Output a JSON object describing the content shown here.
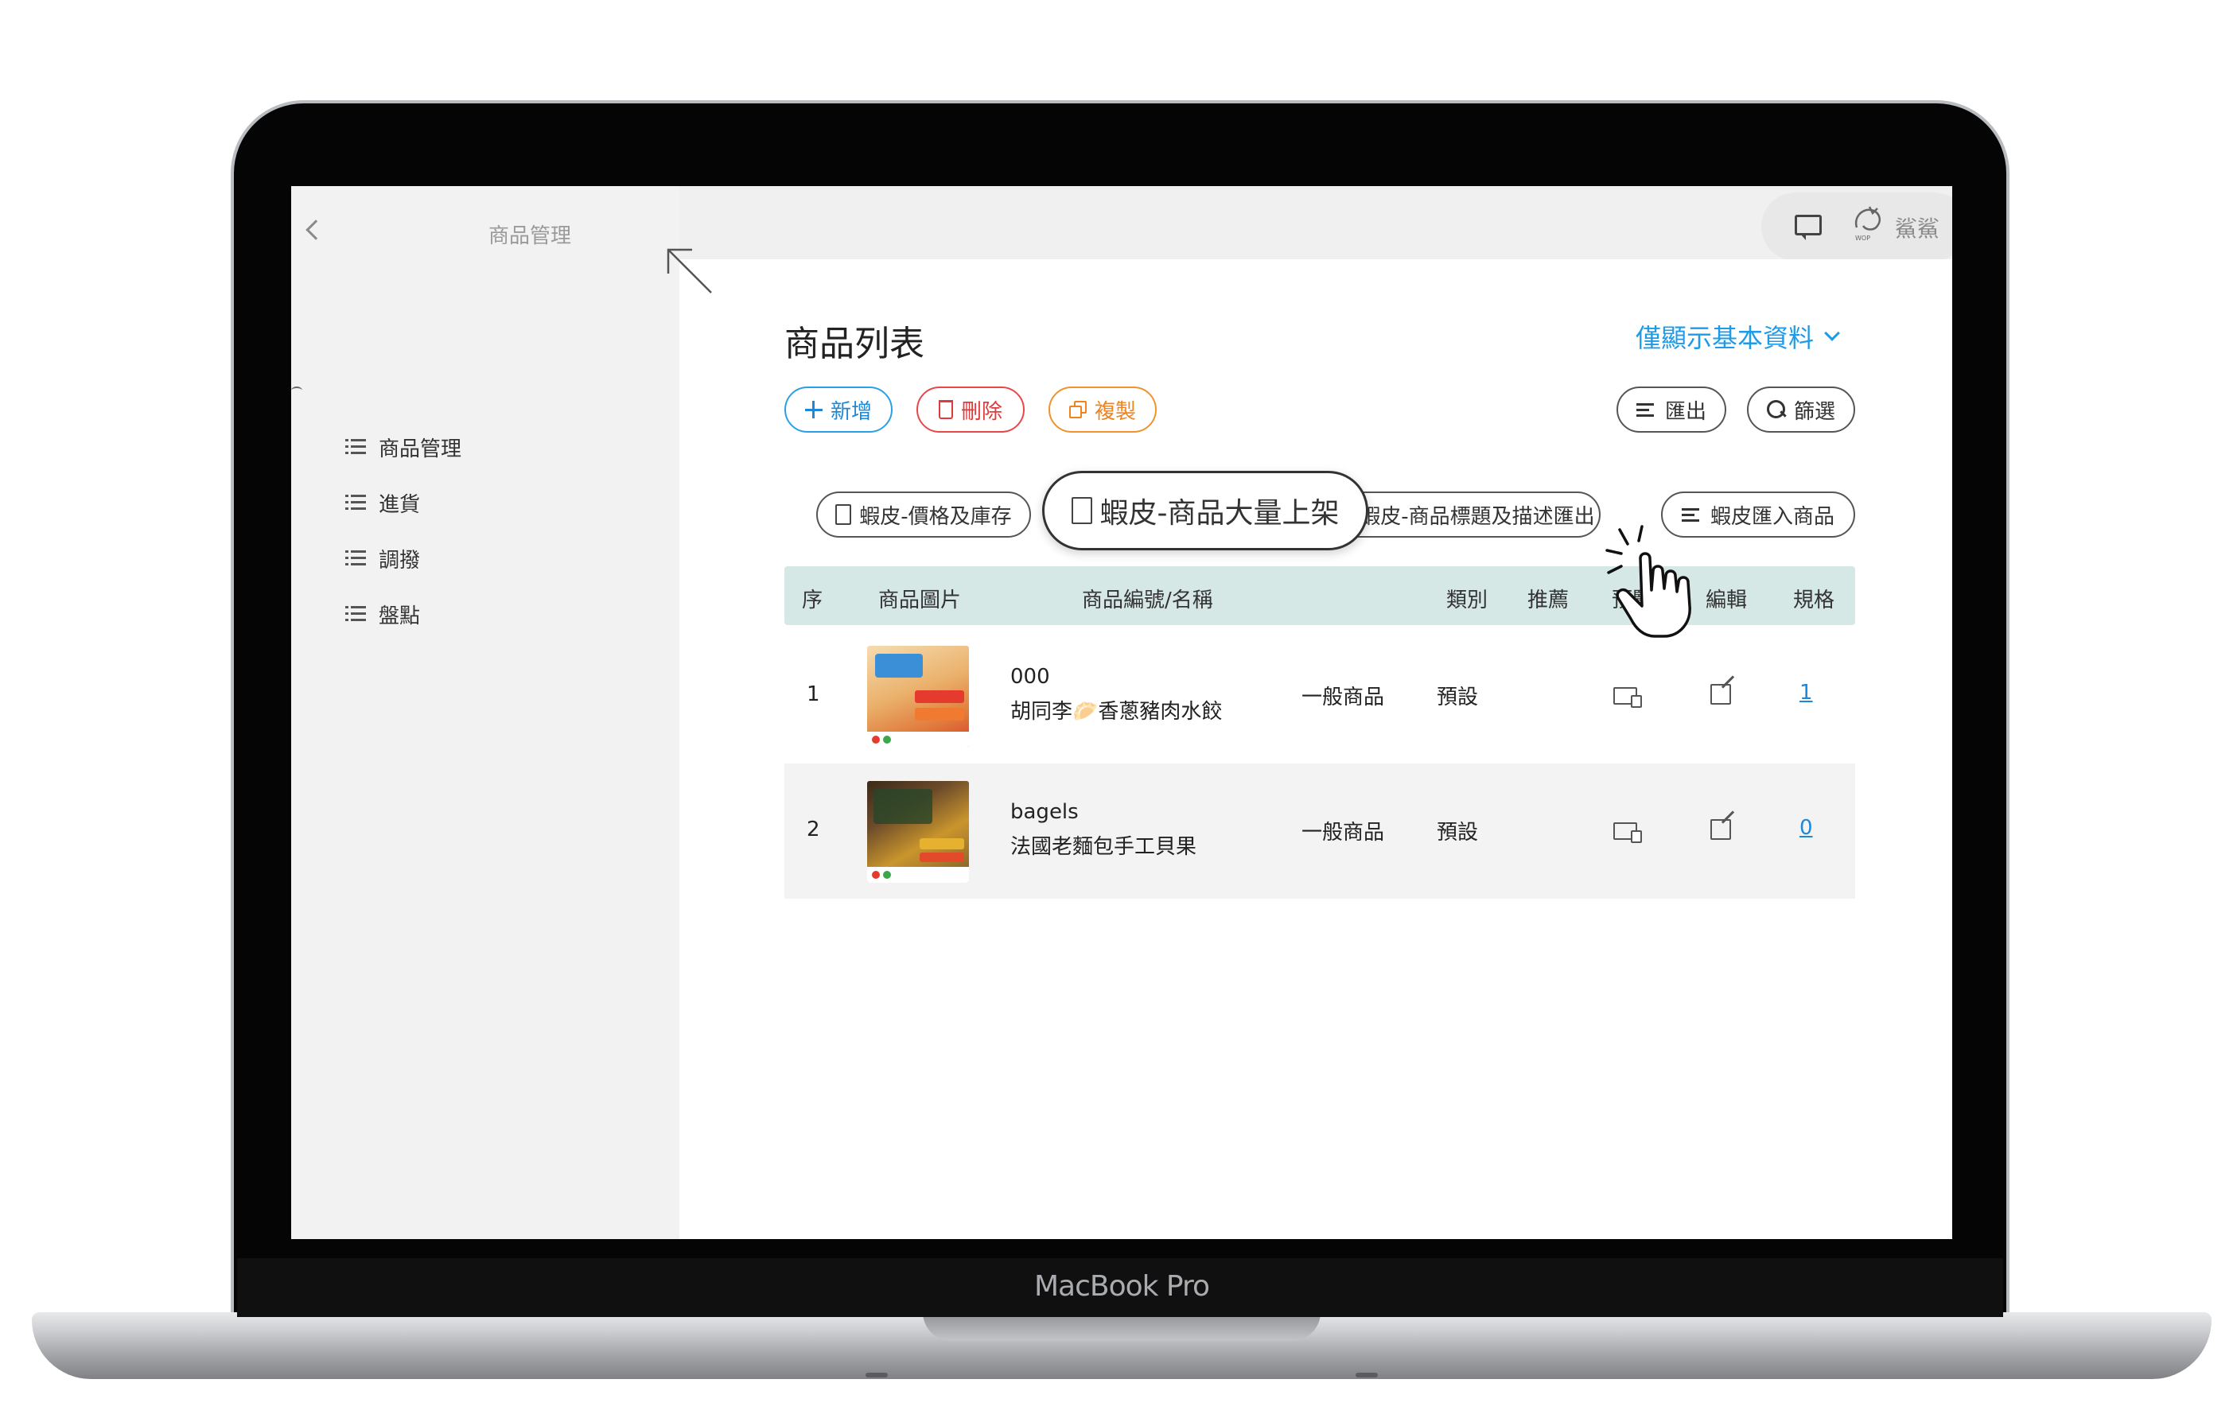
{
  "device": {
    "model": "MacBook Pro"
  },
  "sidebar": {
    "title": "商品管理",
    "items": [
      {
        "label": "商品管理"
      },
      {
        "label": "進貨"
      },
      {
        "label": "調撥"
      },
      {
        "label": "盤點"
      }
    ]
  },
  "topbar": {
    "user_name": "鯊鯊",
    "logo_caption": "WOP"
  },
  "page": {
    "title": "商品列表",
    "view_toggle": "僅顯示基本資料"
  },
  "toolbar": {
    "add_label": "新增",
    "delete_label": "刪除",
    "copy_label": "複製",
    "export_label": "匯出",
    "filter_label": "篩選"
  },
  "shopee_actions": {
    "price_stock": "蝦皮-價格及庫存",
    "bulk_upload": "蝦皮-商品大量上架",
    "title_desc_export": "蝦皮-商品標題及描述匯出",
    "import_products": "蝦皮匯入商品"
  },
  "table": {
    "columns": [
      "序",
      "商品圖片",
      "商品編號/名稱",
      "",
      "類別",
      "推薦",
      "預覽",
      "編輯",
      "規格"
    ],
    "rows": [
      {
        "index": "1",
        "code": "000",
        "name": "胡同李🥟香蔥豬肉水餃",
        "type": "一般商品",
        "category": "預設",
        "spec_count": "1",
        "thumb_colors": [
          "#f3c98f",
          "#e8a45c",
          "#d94f2b"
        ]
      },
      {
        "index": "2",
        "code": "bagels",
        "name": "法國老麵包手工貝果",
        "type": "一般商品",
        "category": "預設",
        "spec_count": "0",
        "thumb_colors": [
          "#6b4a2a",
          "#c9952c",
          "#2f4b2a"
        ]
      }
    ]
  },
  "colors": {
    "accent": "#1e88d6",
    "danger": "#e03b3b",
    "warning": "#ee8420",
    "header_bg": "#d6e8e6"
  }
}
